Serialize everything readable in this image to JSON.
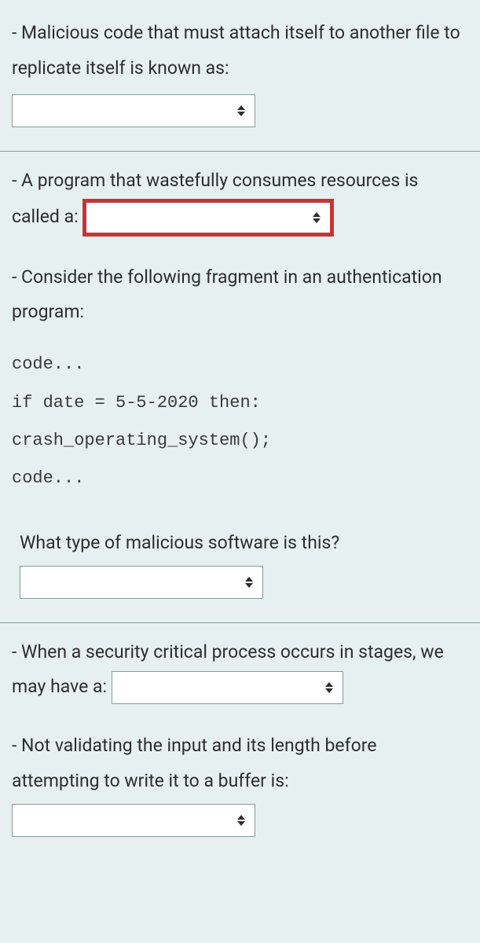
{
  "q1": {
    "text": "- Malicious code that must attach itself to another file to replicate itself is known as:"
  },
  "q2": {
    "part1": "- A program that wastefully consumes resources is called a:"
  },
  "q3": {
    "intro": "- Consider the following fragment in an authentication program:",
    "code_line1": "code...",
    "code_line2": "if date = 5-5-2020 then:",
    "code_line3": "crash_operating_system();",
    "code_line4": "code...",
    "sub": "What type of malicious software is this?"
  },
  "q4": {
    "text": "- When a security critical process occurs in stages, we may have a:"
  },
  "q5": {
    "text": "- Not validating the input and its length before attempting to write it to a buffer is:"
  }
}
